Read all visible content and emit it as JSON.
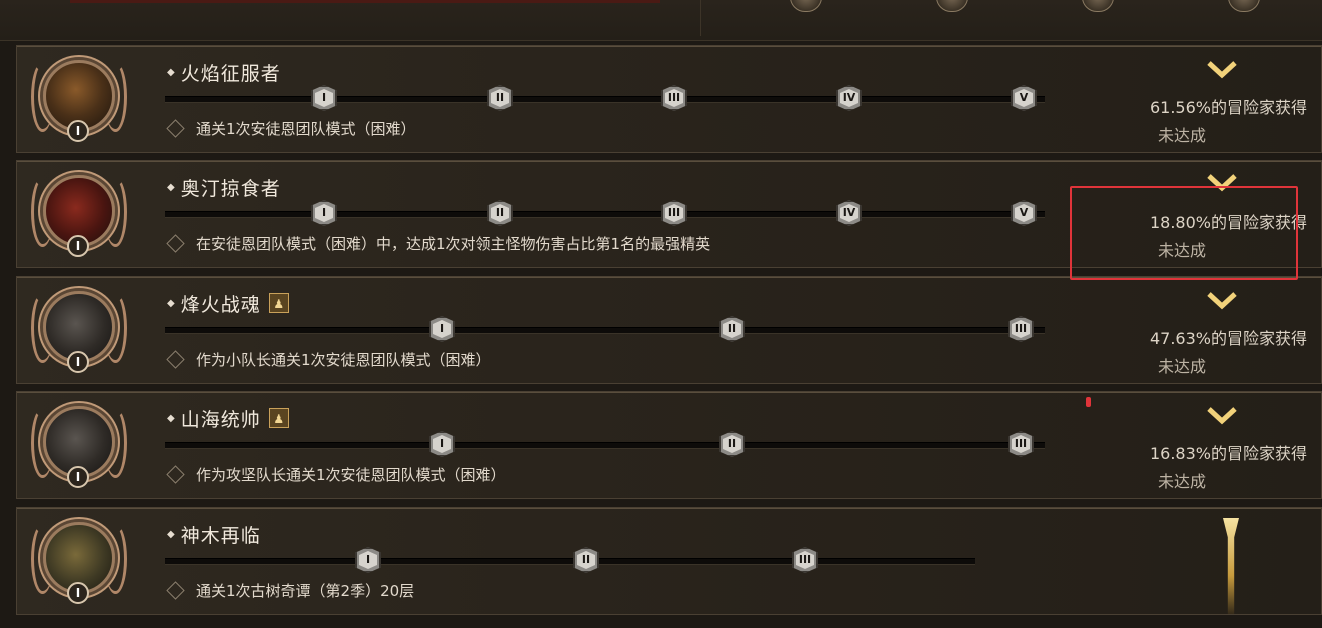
{
  "colors": {
    "accent": "#f2d27a",
    "highlight": "#e0343a",
    "background": "#1d1914"
  },
  "achievements": [
    {
      "title": "火焰征服者",
      "tier_badge": "I",
      "tiers": [
        "I",
        "II",
        "III",
        "IV",
        "V"
      ],
      "description": "通关1次安徒恩团队模式（困难）",
      "percent_text": "61.56%的冒险家获得",
      "status": "未达成",
      "leader_icon": ""
    },
    {
      "title": "奥汀掠食者",
      "tier_badge": "I",
      "tiers": [
        "I",
        "II",
        "III",
        "IV",
        "V"
      ],
      "description": "在安徒恩团队模式（困难）中，达成1次对领主怪物伤害占比第1名的最强精英",
      "percent_text": "18.80%的冒险家获得",
      "status": "未达成",
      "leader_icon": ""
    },
    {
      "title": "烽火战魂",
      "tier_badge": "I",
      "tiers": [
        "I",
        "II",
        "III"
      ],
      "description": "作为小队长通关1次安徒恩团队模式（困难）",
      "percent_text": "47.63%的冒险家获得",
      "status": "未达成",
      "leader_icon": "♟"
    },
    {
      "title": "山海统帅",
      "tier_badge": "I",
      "tiers": [
        "I",
        "II",
        "III"
      ],
      "description": "作为攻坚队长通关1次安徒恩团队模式（困难）",
      "percent_text": "16.83%的冒险家获得",
      "status": "未达成",
      "leader_icon": "♟"
    },
    {
      "title": "神木再临",
      "tier_badge": "I",
      "tiers": [
        "I",
        "II",
        "III"
      ],
      "description": "通关1次古树奇谭（第2季）20层",
      "percent_text": "",
      "status": "",
      "leader_icon": ""
    }
  ]
}
